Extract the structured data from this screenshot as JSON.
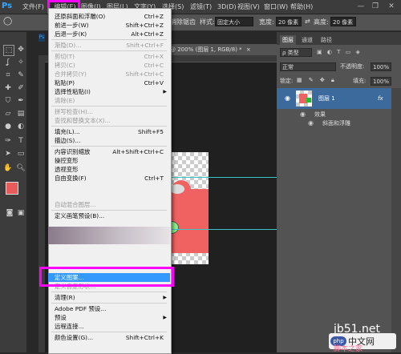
{
  "menubar": {
    "logo": "Ps",
    "items": [
      "文件(F)",
      "编辑(E)",
      "图像(I)",
      "图层(L)",
      "文字(Y)",
      "选择(S)",
      "滤镜(T)",
      "3D(D)",
      "视图(V)",
      "窗口(W)",
      "帮助(H)"
    ],
    "win": [
      "—",
      "❐",
      "✕"
    ]
  },
  "optbar": {
    "feather_tail": "消除锯齿",
    "style_label": "样式:",
    "style_value": "固定大小",
    "width_label": "宽度:",
    "width_value": "20 像素",
    "height_label": "高度:",
    "height_value": "20 像素"
  },
  "document": {
    "tab_label": "Ps",
    "tab_title": "@ 200% (图层 1, RGB/8) *",
    "tab_close": "×"
  },
  "edit_menu": {
    "items": [
      {
        "label": "还原斜面和浮雕(O)",
        "shortcut": "Ctrl+Z",
        "disabled": false
      },
      {
        "label": "前进一步(W)",
        "shortcut": "Shift+Ctrl+Z",
        "disabled": false
      },
      {
        "label": "后退一步(K)",
        "shortcut": "Alt+Ctrl+Z",
        "disabled": false
      },
      {
        "sep": true
      },
      {
        "label": "渐隐(D)...",
        "shortcut": "Shift+Ctrl+F",
        "disabled": true
      },
      {
        "sep": true
      },
      {
        "label": "剪切(T)",
        "shortcut": "Ctrl+X",
        "disabled": true
      },
      {
        "label": "拷贝(C)",
        "shortcut": "Ctrl+C",
        "disabled": true
      },
      {
        "label": "合并拷贝(Y)",
        "shortcut": "Shift+Ctrl+C",
        "disabled": true
      },
      {
        "label": "粘贴(P)",
        "shortcut": "Ctrl+V",
        "disabled": false
      },
      {
        "label": "选择性粘贴(I)",
        "shortcut": "",
        "disabled": false,
        "submenu": true
      },
      {
        "label": "清除(E)",
        "shortcut": "",
        "disabled": true
      },
      {
        "sep": true
      },
      {
        "label": "拼写检查(H)...",
        "shortcut": "",
        "disabled": true
      },
      {
        "label": "查找和替换文本(X)...",
        "shortcut": "",
        "disabled": true
      },
      {
        "sep": true
      },
      {
        "label": "填充(L)...",
        "shortcut": "Shift+F5",
        "disabled": false
      },
      {
        "label": "描边(S)...",
        "shortcut": "",
        "disabled": false
      },
      {
        "sep": true
      },
      {
        "label": "内容识别缩放",
        "shortcut": "Alt+Shift+Ctrl+C",
        "disabled": false
      },
      {
        "label": "操控变形",
        "shortcut": "",
        "disabled": false
      },
      {
        "label": "透视变形",
        "shortcut": "",
        "disabled": false
      },
      {
        "label": "自由变换(F)",
        "shortcut": "Ctrl+T",
        "disabled": false
      },
      {
        "label": "",
        "shortcut": "",
        "disabled": false
      },
      {
        "label": "",
        "shortcut": "",
        "disabled": false
      },
      {
        "label": "自动混合图层...",
        "shortcut": "",
        "disabled": true
      },
      {
        "sep": true
      },
      {
        "label": "定义画笔预设(B)...",
        "shortcut": "",
        "disabled": false
      },
      {
        "label": "定义图案...",
        "shortcut": "",
        "disabled": false,
        "highlight": true
      },
      {
        "label": "定义自定形状...",
        "shortcut": "",
        "disabled": true
      },
      {
        "sep": true
      },
      {
        "label": "清理(R)",
        "shortcut": "",
        "disabled": false,
        "submenu": true
      },
      {
        "sep": true
      },
      {
        "label": "Adobe PDF 预设...",
        "shortcut": "",
        "disabled": false
      },
      {
        "label": "预设",
        "shortcut": "",
        "disabled": false,
        "submenu": true
      },
      {
        "label": "远程连接...",
        "shortcut": "",
        "disabled": false
      },
      {
        "sep": true
      },
      {
        "label": "颜色设置(G)...",
        "shortcut": "Shift+Ctrl+K",
        "disabled": false
      }
    ]
  },
  "panels": {
    "tabs": [
      "图层",
      "通道",
      "路径"
    ],
    "kind_label": "ρ 类型",
    "blend_mode": "正常",
    "opacity_label": "不透明度:",
    "opacity_value": "100%",
    "lock_label": "锁定:",
    "fill_label": "填充:",
    "fill_value": "100%",
    "layer_name": "图层 1",
    "fx": "fx",
    "effects_label": "效果",
    "effect_item": "斜面和浮雕"
  },
  "watermark": {
    "site": "jb51.net",
    "php_label": "php",
    "cn": "中文网",
    "bottom": "脚本之家"
  },
  "colors": {
    "accent_pink": "#ff00ff",
    "highlight_blue": "#3399ff",
    "foreground": "#e85b5b",
    "background": "#1fbf2a",
    "puzzle": "#f06262"
  }
}
